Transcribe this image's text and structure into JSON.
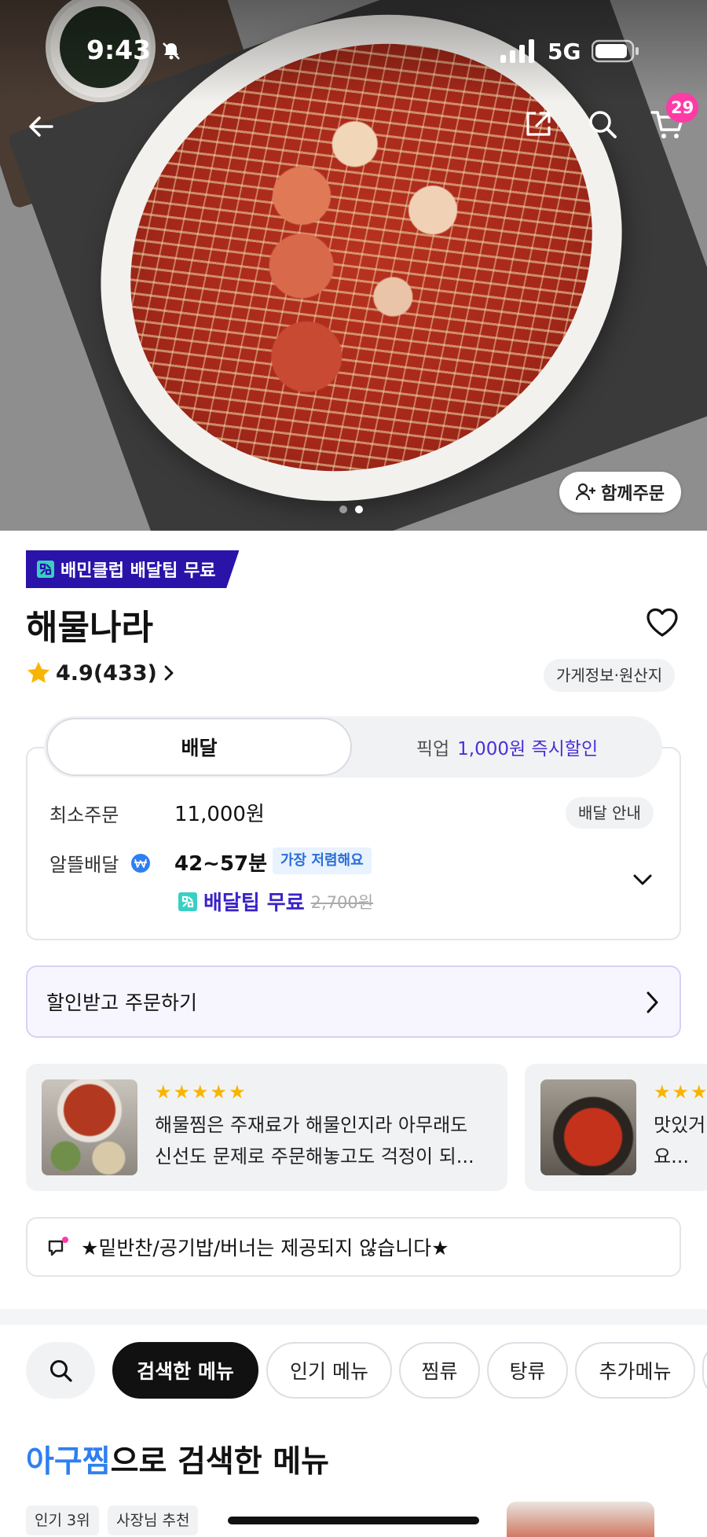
{
  "status_bar": {
    "time": "9:43",
    "network": "5G"
  },
  "header": {
    "cart_count": "29",
    "group_order_label": "함께주문"
  },
  "store": {
    "club_badge": "배민클럽 배달팁 무료",
    "name": "해물나라",
    "rating": "4.9(433)",
    "info_chip": "가게정보·원산지"
  },
  "delivery_tabs": {
    "delivery_label": "배달",
    "pickup_label": "픽업",
    "pickup_promo": "1,000원 즉시할인"
  },
  "delivery_info": {
    "min_order_label": "최소주문",
    "min_order_value": "11,000원",
    "guide_chip": "배달 안내",
    "type_label": "알뜰배달",
    "time_value": "42~57분",
    "cheapest_tag": "가장 저렴해요",
    "tip_free": "배달팁 무료",
    "tip_original": "2,700원"
  },
  "discount_order": {
    "label": "할인받고 주문하기"
  },
  "reviews": [
    {
      "stars": "★★★★★",
      "line1": "해물찜은 주재료가 해물인지라 아무래도",
      "line2": "신선도 문제로 주문해놓고도 걱정이 되..."
    },
    {
      "stars": "★★★",
      "line1": "맛있거",
      "line2": "요..."
    }
  ],
  "notice": {
    "text": "★밑반찬/공기밥/버너는 제공되지 않습니다★"
  },
  "menu_chips": [
    "검색한 메뉴",
    "인기 메뉴",
    "찜류",
    "탕류",
    "추가메뉴"
  ],
  "section": {
    "highlight": "아구찜",
    "rest": "으로 검색한 메뉴"
  },
  "menu_tags": [
    "인기 3위",
    "사장님 추천"
  ],
  "colors": {
    "brand_purple": "#2a13a8",
    "cart_badge": "#ff3ba6",
    "highlight_blue": "#2f7ff0",
    "star": "#f7b500"
  }
}
